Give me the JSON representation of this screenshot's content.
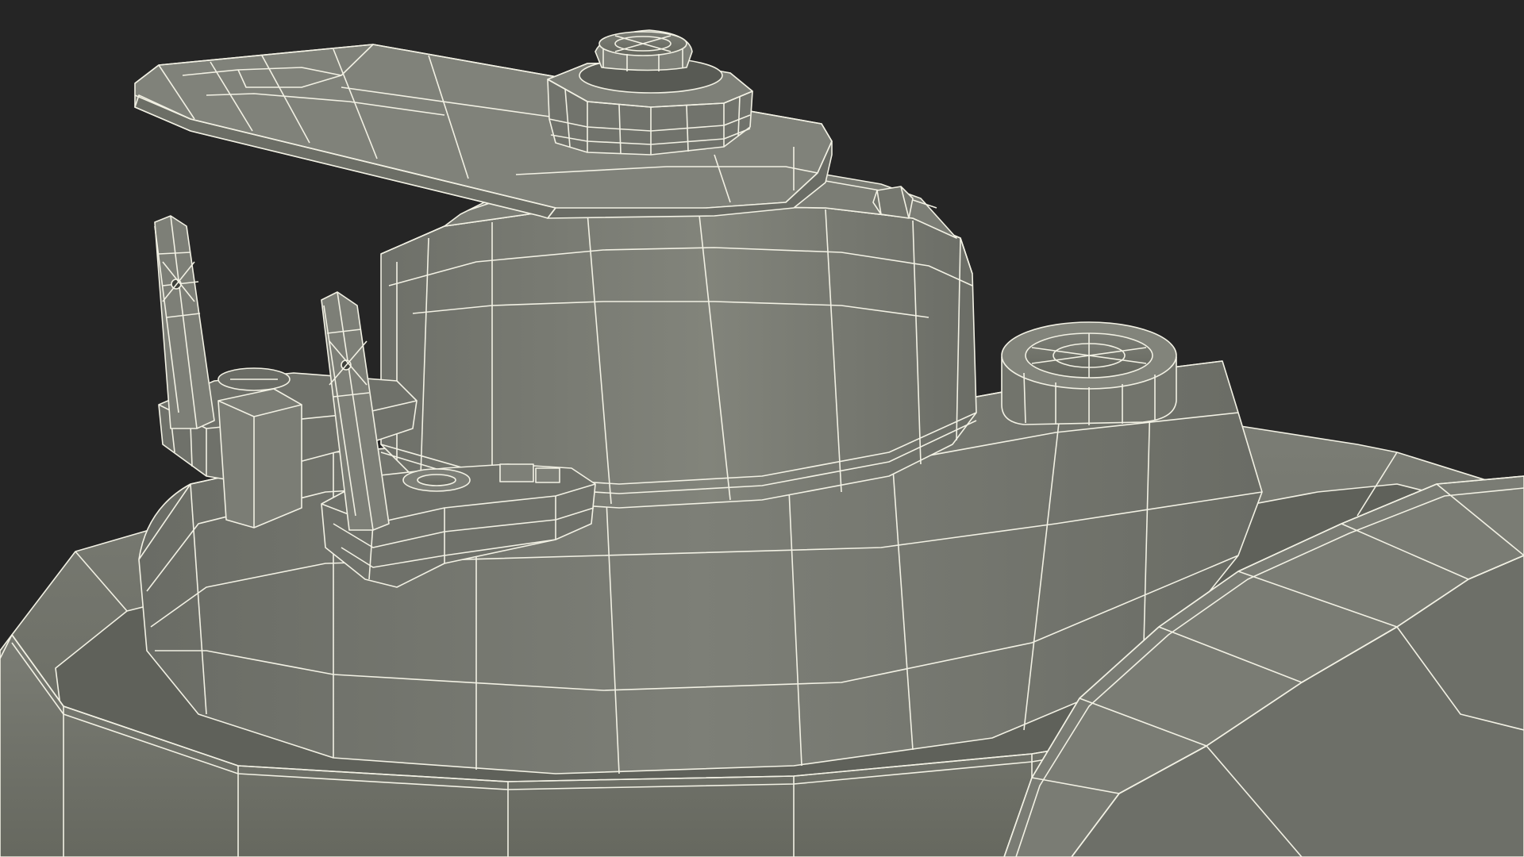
{
  "scene": {
    "background_color": "#252525",
    "surface_color": "#767870",
    "surface_dark": "#5d5f58",
    "surface_light": "#8a8c83",
    "wire_color": "#f2f1e4",
    "objects": [
      "mounting-bracket",
      "hex-nut",
      "dome-cap-top",
      "motor-housing-cap",
      "round-knob",
      "terminal-block",
      "terminal-pin-left",
      "terminal-pin-right",
      "main-housing",
      "base-rim",
      "blade-arm"
    ]
  }
}
